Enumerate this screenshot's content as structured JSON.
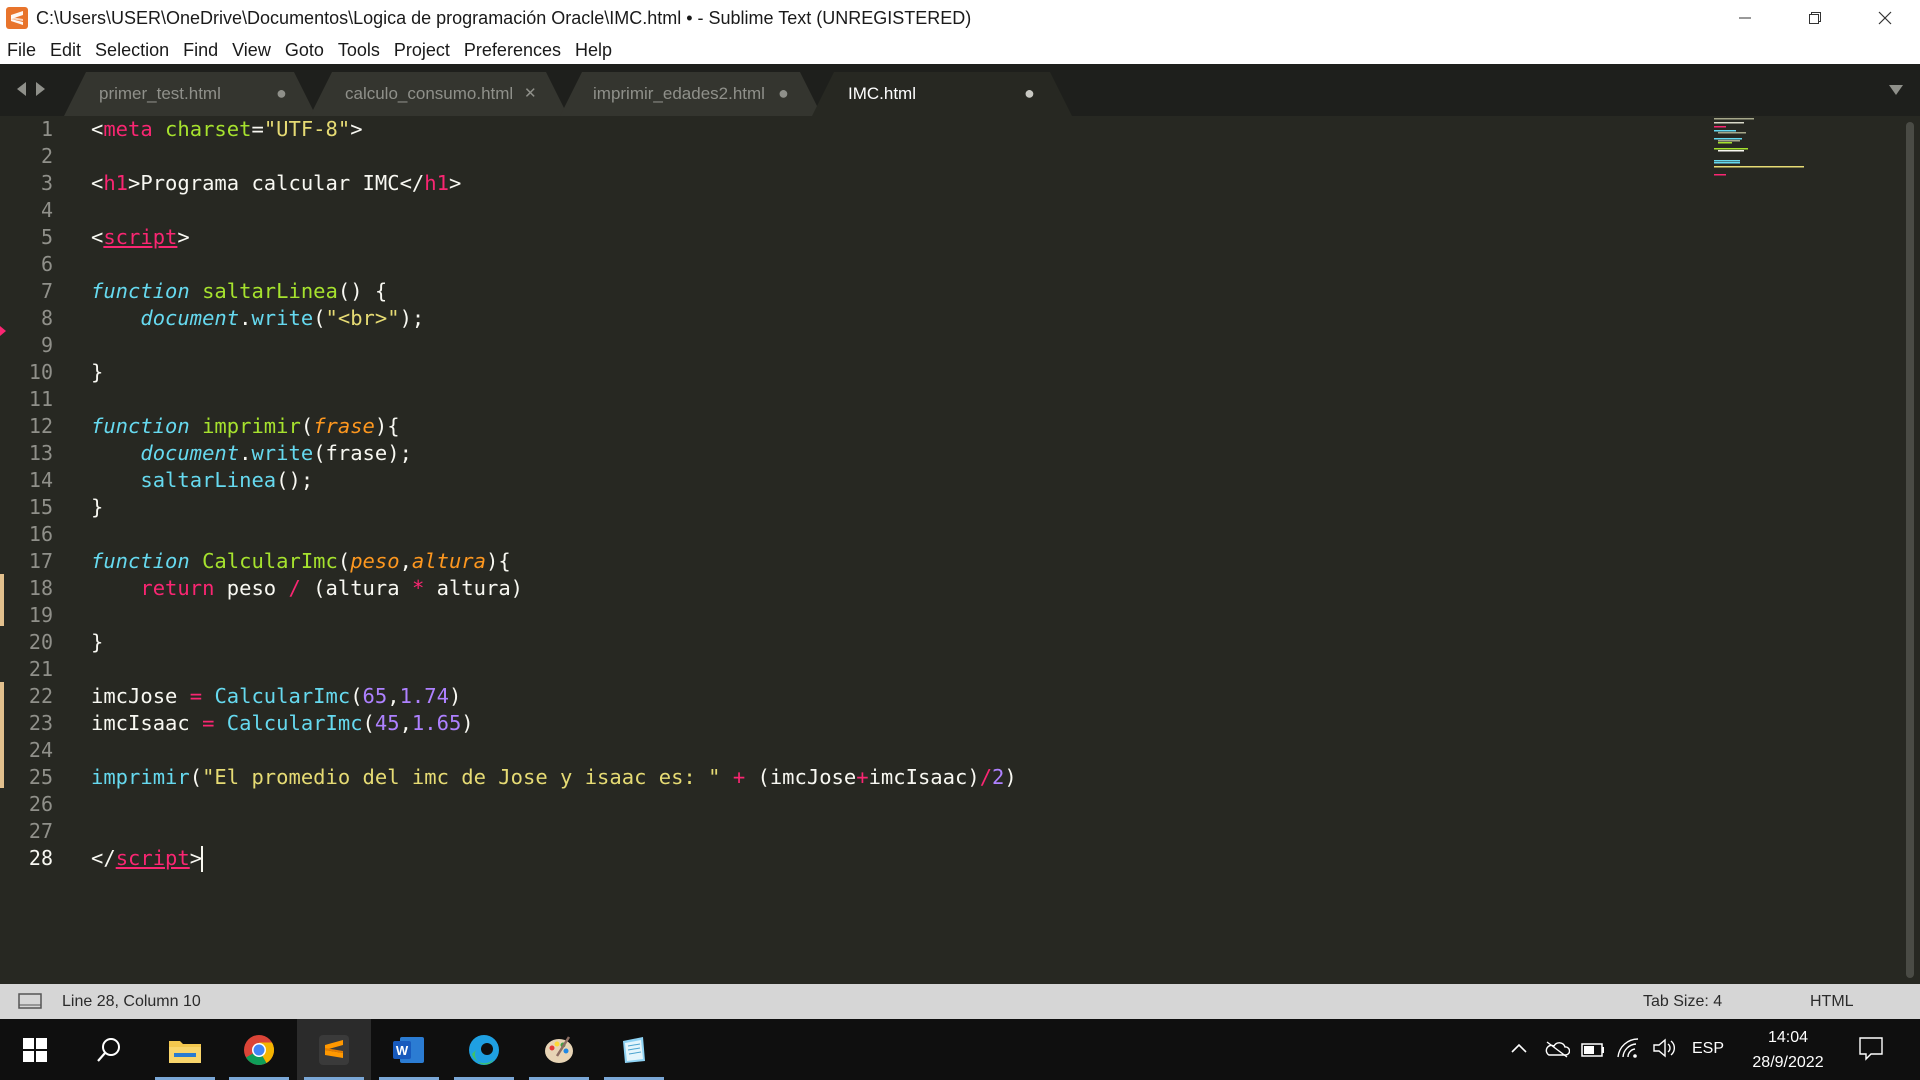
{
  "window": {
    "title": "C:\\Users\\USER\\OneDrive\\Documentos\\Logica de programación Oracle\\IMC.html • - Sublime Text (UNREGISTERED)"
  },
  "menu": [
    "File",
    "Edit",
    "Selection",
    "Find",
    "View",
    "Goto",
    "Tools",
    "Project",
    "Preferences",
    "Help"
  ],
  "tabs": [
    {
      "label": "primer_test.html",
      "state": "modified"
    },
    {
      "label": "calculo_consumo.html",
      "state": "close"
    },
    {
      "label": "imprimir_edades2.html",
      "state": "modified"
    },
    {
      "label": "IMC.html",
      "state": "modified",
      "active": true
    }
  ],
  "tab_marks": {
    "modified": "●",
    "close": "✕"
  },
  "editor": {
    "line_numbers": [
      "1",
      "2",
      "3",
      "4",
      "5",
      "6",
      "7",
      "8",
      "9",
      "10",
      "11",
      "12",
      "13",
      "14",
      "15",
      "16",
      "17",
      "18",
      "19",
      "20",
      "21",
      "22",
      "23",
      "24",
      "25",
      "26",
      "27",
      "28"
    ],
    "current_line": 28,
    "colors": {
      "background": "#272822",
      "tag": "#f92672",
      "string": "#e6db74",
      "keyword": "#66d9ef",
      "function": "#a6e22e",
      "parameter": "#fd971f",
      "number": "#ae81ff"
    },
    "code": {
      "l1": {
        "open": "<",
        "tag": "meta",
        "attr": " charset",
        "eq": "=",
        "str": "\"UTF-8\"",
        "close": ">"
      },
      "l3": {
        "open": "<",
        "tag1": "h1",
        "mid1": ">",
        "text": "Programa calcular IMC",
        "mid2": "</",
        "tag2": "h1",
        "close": ">"
      },
      "l5": {
        "open": "<",
        "tag": "script",
        "close": ">"
      },
      "l7": {
        "kw": "function",
        "fn": " saltarLinea",
        "rest": "() {"
      },
      "l8": {
        "indent": "    ",
        "obj": "document",
        "dot": ".",
        "call": "write",
        "p1": "(",
        "str": "\"<br>\"",
        "p2": ");"
      },
      "l10": {
        "text": "}"
      },
      "l12": {
        "kw": "function",
        "fn": " imprimir",
        "p1": "(",
        "param": "frase",
        "p2": "){"
      },
      "l13": {
        "indent": "    ",
        "obj": "document",
        "dot": ".",
        "call": "write",
        "rest": "(frase);"
      },
      "l14": {
        "indent": "    ",
        "fn": "saltarLinea",
        "rest": "();"
      },
      "l15": {
        "text": "}"
      },
      "l17": {
        "kw": "function",
        "fn": " CalcularImc",
        "p1": "(",
        "param1": "peso",
        "comma": ",",
        "param2": "altura",
        "p2": "){"
      },
      "l18": {
        "indent": "    ",
        "ret": "return",
        "a": " peso ",
        "op1": "/",
        "b": " (altura ",
        "op2": "*",
        "c": " altura)"
      },
      "l20": {
        "text": "}"
      },
      "l22": {
        "var": "imcJose ",
        "op": "=",
        "sp": " ",
        "call": "CalcularImc",
        "p1": "(",
        "n1": "65",
        "comma": ",",
        "n2": "1.74",
        "p2": ")"
      },
      "l23": {
        "var": "imcIsaac ",
        "op": "=",
        "sp": " ",
        "call": "CalcularImc",
        "p1": "(",
        "n1": "45",
        "comma": ",",
        "n2": "1.65",
        "p2": ")"
      },
      "l25": {
        "call": "imprimir",
        "p1": "(",
        "str": "\"El promedio del imc de Jose y isaac es: \"",
        "sp1": " ",
        "op1": "+",
        "a": " (imcJose",
        "op2": "+",
        "b": "imcIsaac)",
        "op3": "/",
        "n": "2",
        "p2": ")"
      },
      "l28": {
        "open": "</",
        "tag": "script",
        "close": ">"
      }
    }
  },
  "status": {
    "position": "Line 28, Column 10",
    "tab_size": "Tab Size: 4",
    "syntax": "HTML"
  },
  "taskbar": {
    "language": "ESP",
    "time": "14:04",
    "date": "28/9/2022"
  }
}
